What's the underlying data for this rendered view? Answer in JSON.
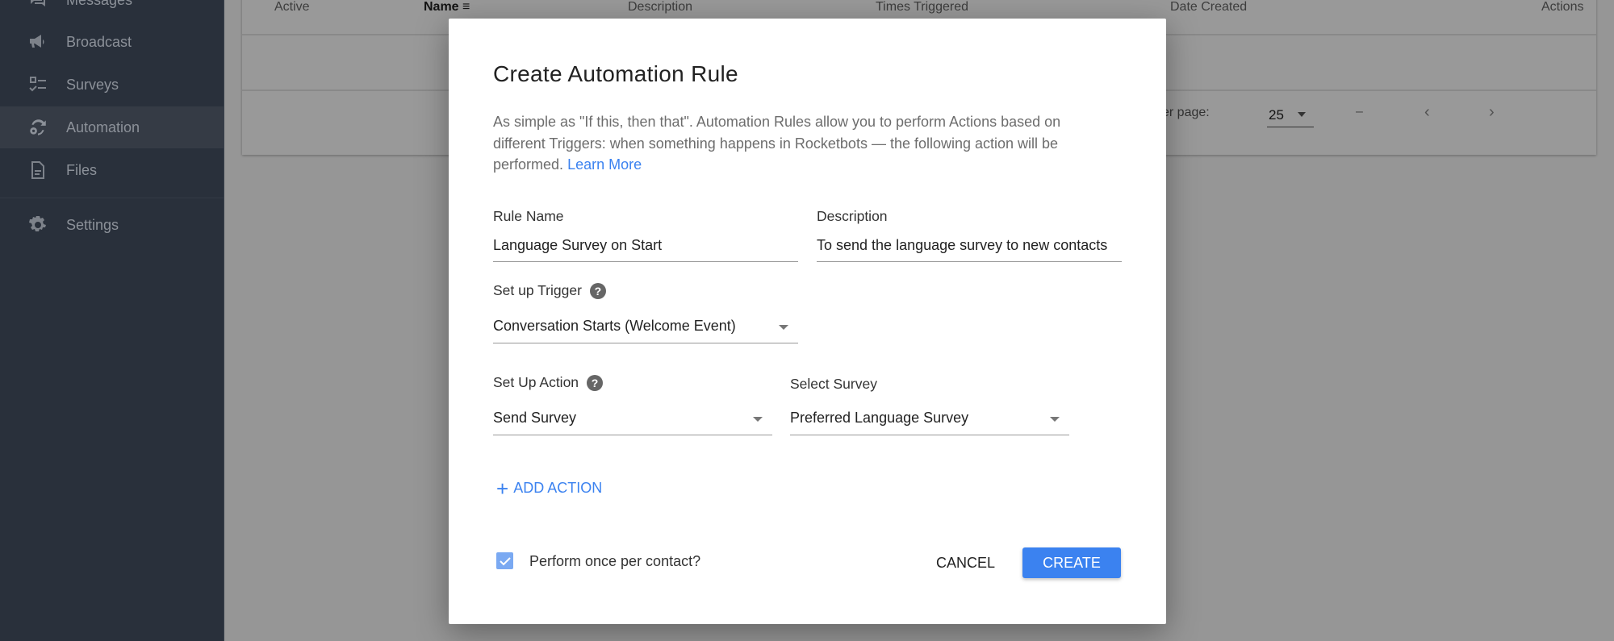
{
  "sidebar": {
    "items": [
      {
        "label": "Messages",
        "icon": "chat-icon",
        "active": false
      },
      {
        "label": "Broadcast",
        "icon": "megaphone-icon",
        "active": false
      },
      {
        "label": "Surveys",
        "icon": "checklist-icon",
        "active": false
      },
      {
        "label": "Automation",
        "icon": "automation-gear-sync-icon",
        "active": true
      },
      {
        "label": "Files",
        "icon": "file-icon",
        "active": false
      },
      {
        "label": "Settings",
        "icon": "gear-icon",
        "active": false
      }
    ]
  },
  "table": {
    "columns": [
      "Active",
      "Name",
      "Description",
      "Times Triggered",
      "Date Created",
      "Actions"
    ],
    "sorted_column": "Name",
    "pagination": {
      "rows_per_page_label": "Rows per page:",
      "rows_per_page_visible": "er page:",
      "rows_per_page_value": "25",
      "range": "–",
      "prev": "‹",
      "next": "›"
    }
  },
  "modal": {
    "title": "Create Automation Rule",
    "description": "As simple as \"If this, then that\". Automation Rules allow you to perform Actions based on different Triggers: when something happens in Rocketbots — the following action will be performed.",
    "learn_more": "Learn More",
    "rule_name": {
      "label": "Rule Name",
      "value": "Language Survey on Start"
    },
    "description_field": {
      "label": "Description",
      "value": "To send the language survey to new contacts"
    },
    "trigger": {
      "label": "Set up Trigger",
      "value": "Conversation Starts (Welcome Event)"
    },
    "action": {
      "label": "Set Up Action",
      "value": "Send Survey"
    },
    "survey": {
      "label": "Select Survey",
      "value": "Preferred Language Survey"
    },
    "add_action": "ADD ACTION",
    "perform_once": {
      "label": "Perform once per contact?",
      "checked": true
    },
    "cancel": "CANCEL",
    "create": "CREATE"
  },
  "colors": {
    "accent": "#3b82f0",
    "sidebar_bg": "#29303b",
    "checkbox": "#7aa9f2"
  }
}
